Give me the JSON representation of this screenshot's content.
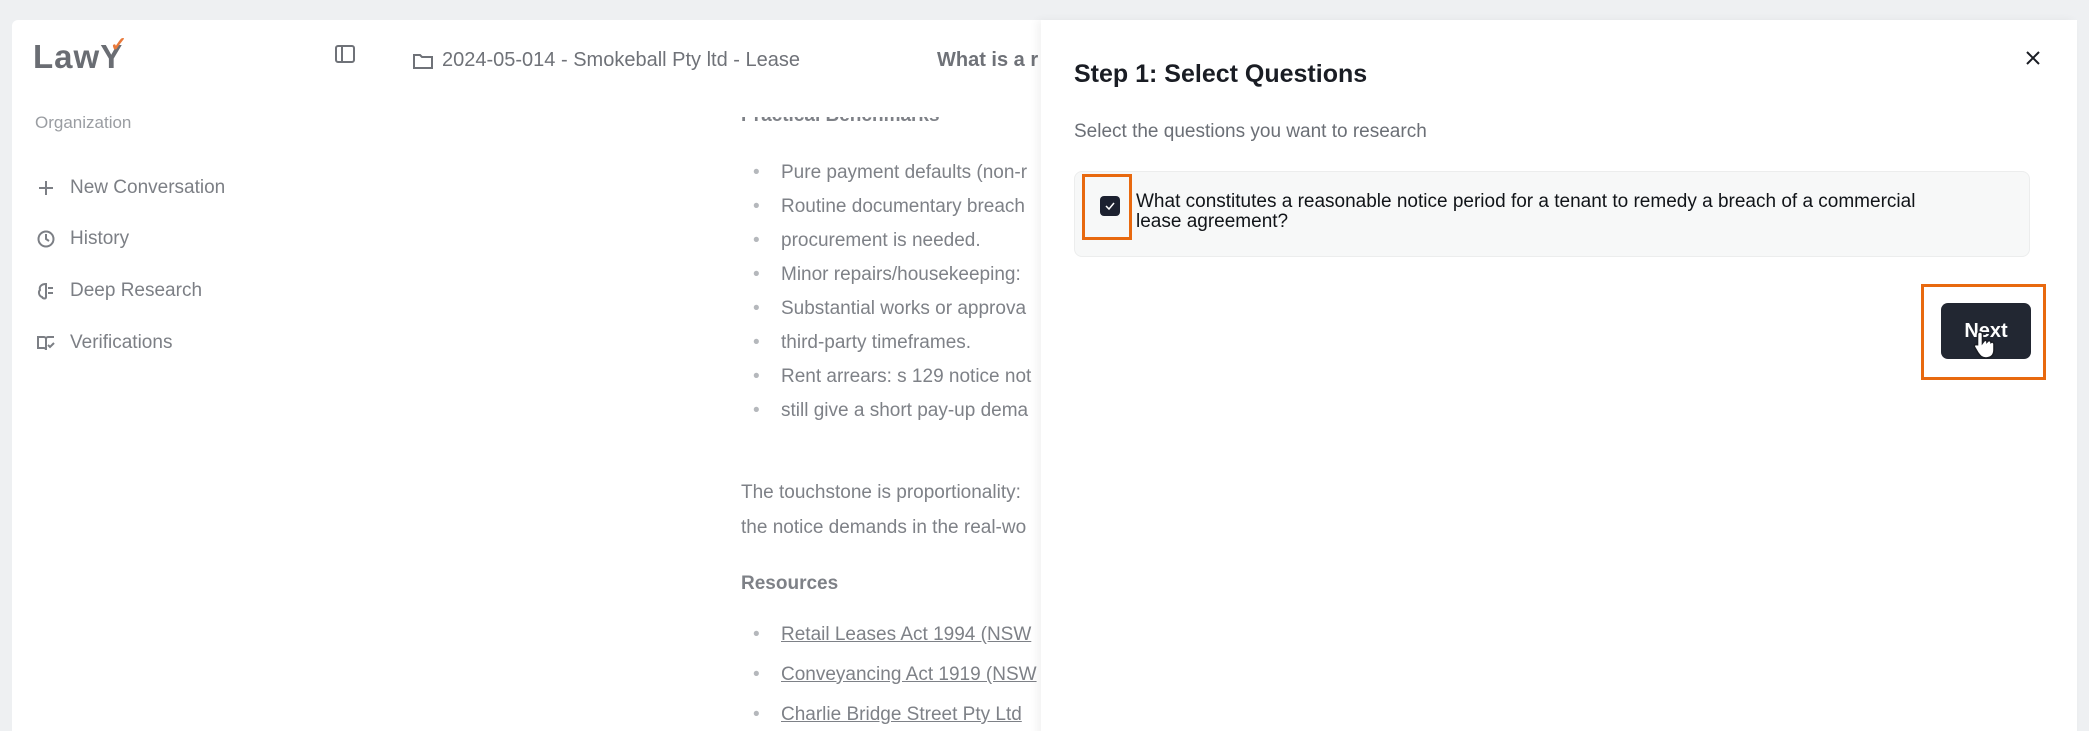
{
  "sidebar": {
    "logo": "Law",
    "section_label": "Organization",
    "items": [
      {
        "label": "New Conversation",
        "icon": "plus-icon"
      },
      {
        "label": "History",
        "icon": "history-icon"
      },
      {
        "label": "Deep Research",
        "icon": "brain-icon"
      },
      {
        "label": "Verifications",
        "icon": "book-check-icon"
      }
    ]
  },
  "header": {
    "breadcrumb": "2024-05-014 - Smokeball Pty ltd - Lease",
    "chat_title": "What is a r"
  },
  "content": {
    "heading": "Practical Benchmarks",
    "bullets": [
      "Pure payment defaults (non-r",
      "Routine documentary breach",
      "procurement is needed.",
      "Minor repairs/housekeeping:",
      "Substantial works or approva",
      "third-party timeframes.",
      "Rent arrears: s 129 notice not",
      "still give a short pay-up dema"
    ],
    "paragraph_line1": "The touchstone is proportionality:",
    "paragraph_line2": "the notice demands in the real-wo",
    "resources_heading": "Resources",
    "links": [
      "Retail Leases Act 1994 (NSW",
      "Conveyancing Act 1919 (NSW",
      "Charlie Bridge Street Pty Ltd"
    ]
  },
  "panel": {
    "title": "Step 1: Select Questions",
    "subtitle": "Select the questions you want to research",
    "question_line1": "What constitutes a reasonable notice period for a tenant to remedy a breach of a commercial",
    "question_line2": "lease agreement?",
    "question_checked": true,
    "next_label": "Next"
  },
  "colors": {
    "accent_highlight": "#e8690f",
    "button_dark": "#222732",
    "logo_tick": "#e9793a"
  }
}
